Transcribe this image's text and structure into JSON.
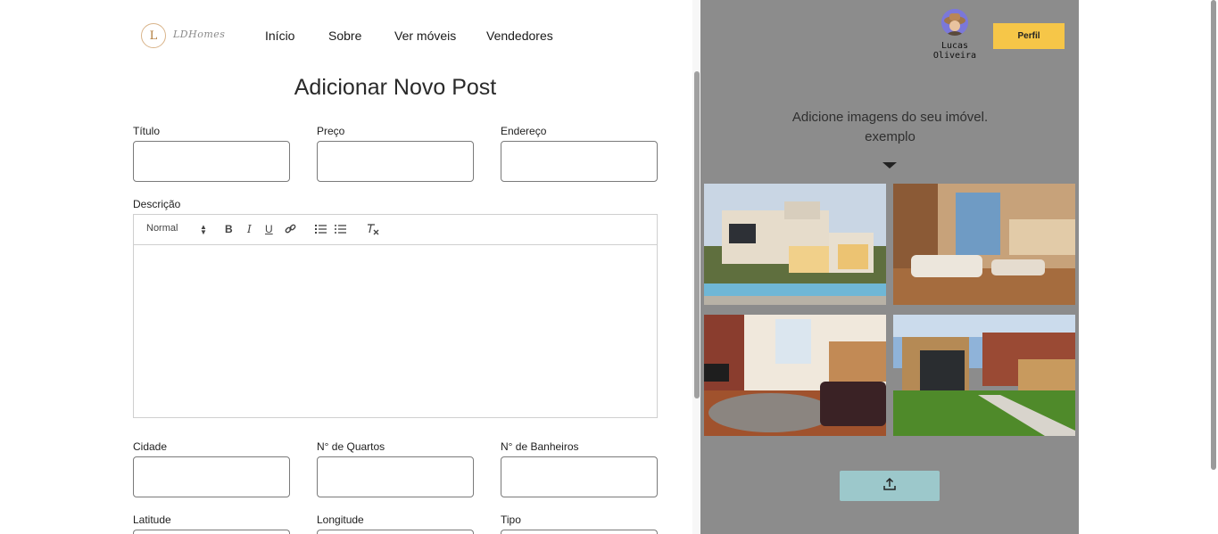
{
  "nav": {
    "logo_letter": "L",
    "brand": "LDHomes",
    "links": [
      "Início",
      "Sobre",
      "Ver móveis",
      "Vendedores"
    ]
  },
  "form": {
    "title": "Adicionar Novo Post",
    "fields": {
      "titulo": "Título",
      "preco": "Preço",
      "endereco": "Endereço",
      "descricao": "Descrição",
      "cidade": "Cidade",
      "quartos": "N° de Quartos",
      "banheiros": "N° de Banheiros",
      "latitude": "Latitude",
      "longitude": "Longitude",
      "tipo": "Tipo"
    },
    "editor": {
      "heading_select": "Normal",
      "bold": "B",
      "italic": "I",
      "underline": "U"
    }
  },
  "user": {
    "name_line1": "Lucas",
    "name_line2": "Oliveira",
    "profile_button": "Perfil"
  },
  "panel": {
    "hint_line1": "Adicione imagens do seu imóvel.",
    "hint_line2": "exemplo"
  },
  "colors": {
    "panel_bg": "#8c8c8c",
    "profile_button": "#f6c648",
    "upload_button": "#9cc8cb"
  },
  "icons": [
    "link-icon",
    "ordered-list-icon",
    "bullet-list-icon",
    "clear-format-icon",
    "upload-icon",
    "caret-down-icon",
    "avatar-icon"
  ]
}
